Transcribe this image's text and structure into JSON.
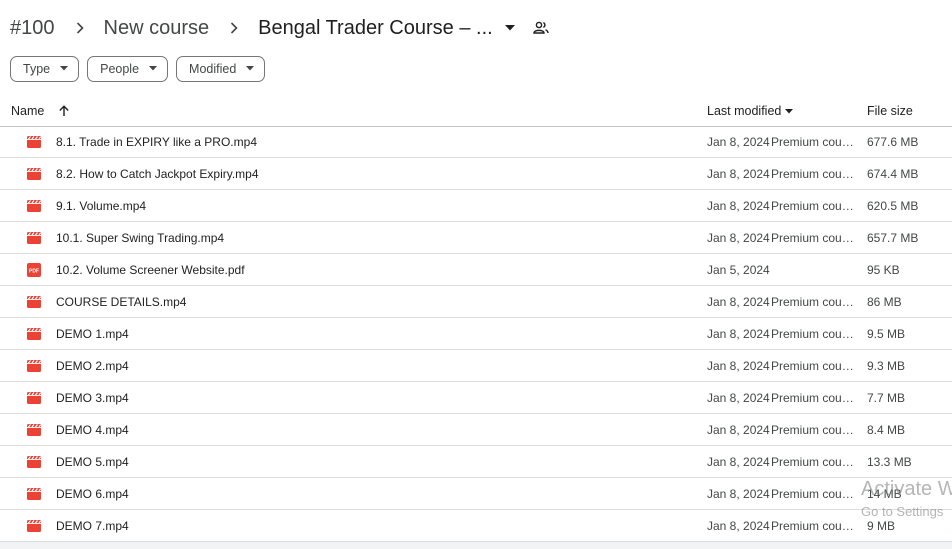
{
  "breadcrumb": {
    "items": [
      "#100",
      "New course",
      "Bengal Trader Course – ..."
    ]
  },
  "filters": [
    {
      "label": "Type"
    },
    {
      "label": "People"
    },
    {
      "label": "Modified"
    }
  ],
  "table": {
    "headers": {
      "name": "Name",
      "last_modified": "Last modified",
      "file_size": "File size"
    },
    "rows": [
      {
        "type": "video",
        "name": "8.1. Trade in EXPIRY like a PRO.mp4",
        "date": "Jan 8, 2024",
        "owner": "Premium cours...",
        "size": "677.6 MB"
      },
      {
        "type": "video",
        "name": "8.2. How to Catch Jackpot Expiry.mp4",
        "date": "Jan 8, 2024",
        "owner": "Premium cours...",
        "size": "674.4 MB"
      },
      {
        "type": "video",
        "name": "9.1. Volume.mp4",
        "date": "Jan 8, 2024",
        "owner": "Premium cours...",
        "size": "620.5 MB"
      },
      {
        "type": "video",
        "name": "10.1. Super Swing Trading.mp4",
        "date": "Jan 8, 2024",
        "owner": "Premium cours...",
        "size": "657.7 MB"
      },
      {
        "type": "pdf",
        "name": "10.2. Volume Screener Website.pdf",
        "date": "Jan 5, 2024",
        "owner": "",
        "size": "95 KB"
      },
      {
        "type": "video",
        "name": "COURSE DETAILS.mp4",
        "date": "Jan 8, 2024",
        "owner": "Premium cours...",
        "size": "86 MB"
      },
      {
        "type": "video",
        "name": "DEMO 1.mp4",
        "date": "Jan 8, 2024",
        "owner": "Premium cours...",
        "size": "9.5 MB"
      },
      {
        "type": "video",
        "name": "DEMO 2.mp4",
        "date": "Jan 8, 2024",
        "owner": "Premium cours...",
        "size": "9.3 MB"
      },
      {
        "type": "video",
        "name": "DEMO 3.mp4",
        "date": "Jan 8, 2024",
        "owner": "Premium cours...",
        "size": "7.7 MB"
      },
      {
        "type": "video",
        "name": "DEMO 4.mp4",
        "date": "Jan 8, 2024",
        "owner": "Premium cours...",
        "size": "8.4 MB"
      },
      {
        "type": "video",
        "name": "DEMO 5.mp4",
        "date": "Jan 8, 2024",
        "owner": "Premium cours...",
        "size": "13.3 MB"
      },
      {
        "type": "video",
        "name": "DEMO 6.mp4",
        "date": "Jan 8, 2024",
        "owner": "Premium cours...",
        "size": "14 MB"
      },
      {
        "type": "video",
        "name": "DEMO 7.mp4",
        "date": "Jan 8, 2024",
        "owner": "Premium cours...",
        "size": "9 MB"
      }
    ]
  },
  "watermark": {
    "line1": "Activate W",
    "line2": "Go to Settings"
  },
  "colors": {
    "file_icon_red": "#ea4335",
    "text_primary": "#1f1f1f",
    "text_secondary": "#444746",
    "divider": "#dadce0"
  },
  "icons": {
    "video": "video-file-icon",
    "pdf": "pdf-file-icon"
  }
}
